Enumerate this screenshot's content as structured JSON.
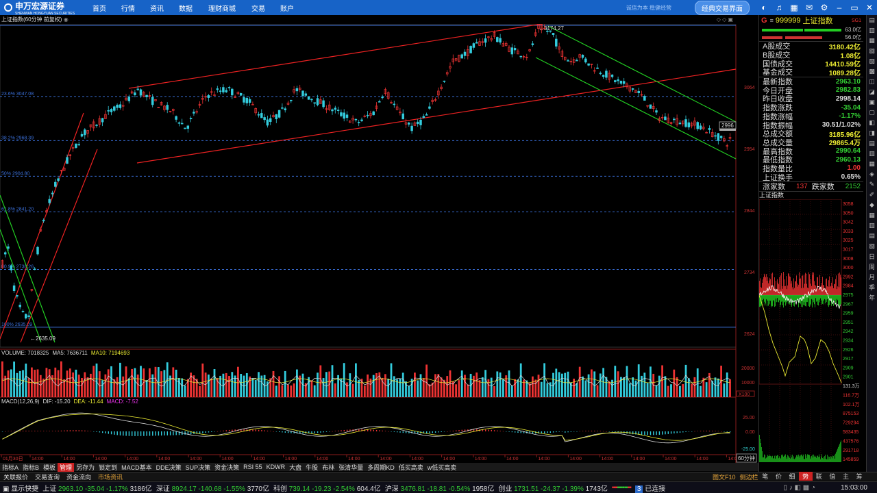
{
  "brand": {
    "name": "申万宏源证券",
    "sub": "SHENWAN HONGYUAN SECURITIES"
  },
  "nav": [
    "首页",
    "行情",
    "资讯",
    "数据",
    "理财商城",
    "交易",
    "账户"
  ],
  "top_right": {
    "slogan": "诚信为本 稳健经营",
    "classic_button": "经典交易界面"
  },
  "chart": {
    "title": "上证指数(60分钟 前复权)",
    "period_label": "60分钟",
    "high_label": "3174.27",
    "low_label": "2635.09",
    "last_label": "2996",
    "fib_levels": [
      {
        "label": "23.6% 3047.08"
      },
      {
        "label": "38.2% 2968.39"
      },
      {
        "label": "50% 2904.80"
      },
      {
        "label": "61.8% 2841.20"
      },
      {
        "label": "80.9% 2738.26"
      },
      {
        "label": "100% 2635.09"
      }
    ],
    "price_axis": [
      "3064",
      "2954",
      "2844",
      "2734",
      "2624"
    ],
    "volume_axis": [
      "20000",
      "10000",
      "X100"
    ],
    "macd_axis": [
      "25.00",
      "0.00",
      "-25.00"
    ],
    "time_ticks": [
      "01月30日",
      "14:00",
      "14:00",
      "14:00",
      "14:00",
      "14:00",
      "14:00",
      "14:00",
      "14:00",
      "14:00",
      "14:00",
      "14:00",
      "14:00",
      "14:00",
      "14:00",
      "14:00",
      "14:00",
      "14:00",
      "14:00",
      "14:00",
      "14:00",
      "14:00",
      "14:00",
      "14:00"
    ]
  },
  "volume": {
    "name": "VOLUME: 7018325",
    "ma5": "MA5: 7636711",
    "ma10": "MA10: 7194693"
  },
  "macd": {
    "name": "MACD(12,26,9)",
    "dif": "DIF: -15.20",
    "dea": "DEA: -11.44",
    "macd": "MACD: -7.52"
  },
  "quote": {
    "code": "999999",
    "name": "上证指数",
    "badge": "SG1",
    "bar_amt_up": "63.0亿",
    "bar_amt_down": "56.0亿",
    "rows1": [
      {
        "k": "A股成交",
        "v": "3180.42亿",
        "c": "#ee3"
      },
      {
        "k": "B股成交",
        "v": "1.08亿",
        "c": "#ee3"
      },
      {
        "k": "国债成交",
        "v": "14410.59亿",
        "c": "#ee3"
      },
      {
        "k": "基金成交",
        "v": "1089.28亿",
        "c": "#ee3"
      }
    ],
    "rows2": [
      {
        "k": "最新指数",
        "v": "2963.10",
        "c": "#3c3"
      },
      {
        "k": "今日开盘",
        "v": "2982.83",
        "c": "#3c3"
      },
      {
        "k": "昨日收盘",
        "v": "2998.14",
        "c": "#ddd"
      },
      {
        "k": "指数涨跌",
        "v": "-35.04",
        "c": "#3c3"
      },
      {
        "k": "指数涨幅",
        "v": "-1.17%",
        "c": "#3c3"
      },
      {
        "k": "指数振幅",
        "v": "30.51/1.02%",
        "c": "#ddd"
      },
      {
        "k": "总成交额",
        "v": "3185.96亿",
        "c": "#ee3"
      },
      {
        "k": "总成交量",
        "v": "29865.4万",
        "c": "#ee3"
      },
      {
        "k": "最高指数",
        "v": "2990.64",
        "c": "#3c3"
      },
      {
        "k": "最低指数",
        "v": "2960.13",
        "c": "#3c3"
      },
      {
        "k": "指数量比",
        "v": "1.00",
        "c": "#e33"
      },
      {
        "k": "上证换手",
        "v": "0.65%",
        "c": "#ddd"
      }
    ],
    "up_label": "涨家数",
    "up_count": "137",
    "down_label": "跌家数",
    "down_count": "2152",
    "mini_title": "上证指数",
    "mini_axis": [
      "3058",
      "3050",
      "3042",
      "3033",
      "3025",
      "3017",
      "3008",
      "3000",
      "2992",
      "2984",
      "2975",
      "2967",
      "2959",
      "2951",
      "2942",
      "2934",
      "2926",
      "2917",
      "2909",
      "2901"
    ],
    "mini_vol_axis": [
      "131.3万",
      "116.7万",
      "102.1万",
      "875153",
      "729294",
      "583435",
      "437576",
      "291718",
      "145859"
    ]
  },
  "right_toolbar": [
    "日",
    "周",
    "月",
    "季",
    "年"
  ],
  "tabs1": [
    "指标A",
    "指标B",
    "模板",
    "管理",
    "另存为",
    "锁定到",
    "MACD基本",
    "DDE决策",
    "SUP决策",
    "资金决策",
    "RSI 55",
    "KDWR",
    "大盘",
    "牛股",
    "布林",
    "张清华量",
    "多周期KD",
    "低买高卖",
    "w低买高卖"
  ],
  "tabs1_active": "管理",
  "tabs2": [
    "关联报价",
    "交易查询",
    "资金流向",
    "市场资讯"
  ],
  "tabs2_active": "市场资讯",
  "tabs2_right": [
    "图文F10",
    "侧边栏"
  ],
  "rp_tabs": [
    "笔",
    "价",
    "细",
    "势",
    "联",
    "值",
    "主",
    "筹"
  ],
  "rp_tabs_active": "势",
  "status": {
    "quick": "显示快捷",
    "sh": {
      "name": "上证",
      "price": "2963.10",
      "chg": "-35.04",
      "pct": "-1.17%",
      "amt": "3186亿"
    },
    "sz": {
      "name": "深证",
      "price": "8924.17",
      "chg": "-140.68",
      "pct": "-1.55%",
      "amt": "3770亿"
    },
    "kc": {
      "name": "科创",
      "price": "739.14",
      "chg": "-19.23",
      "pct": "-2.54%",
      "amt": "604.4亿"
    },
    "hs": {
      "name": "沪深",
      "price": "3476.81",
      "chg": "-18.81",
      "pct": "-0.54%",
      "amt": "1958亿"
    },
    "cy": {
      "name": "创业",
      "price": "1731.51",
      "chg": "-24.37",
      "pct": "-1.39%",
      "amt": "1743亿"
    },
    "conn_count": "3",
    "conn": "已连接",
    "time": "15:03:00"
  }
}
